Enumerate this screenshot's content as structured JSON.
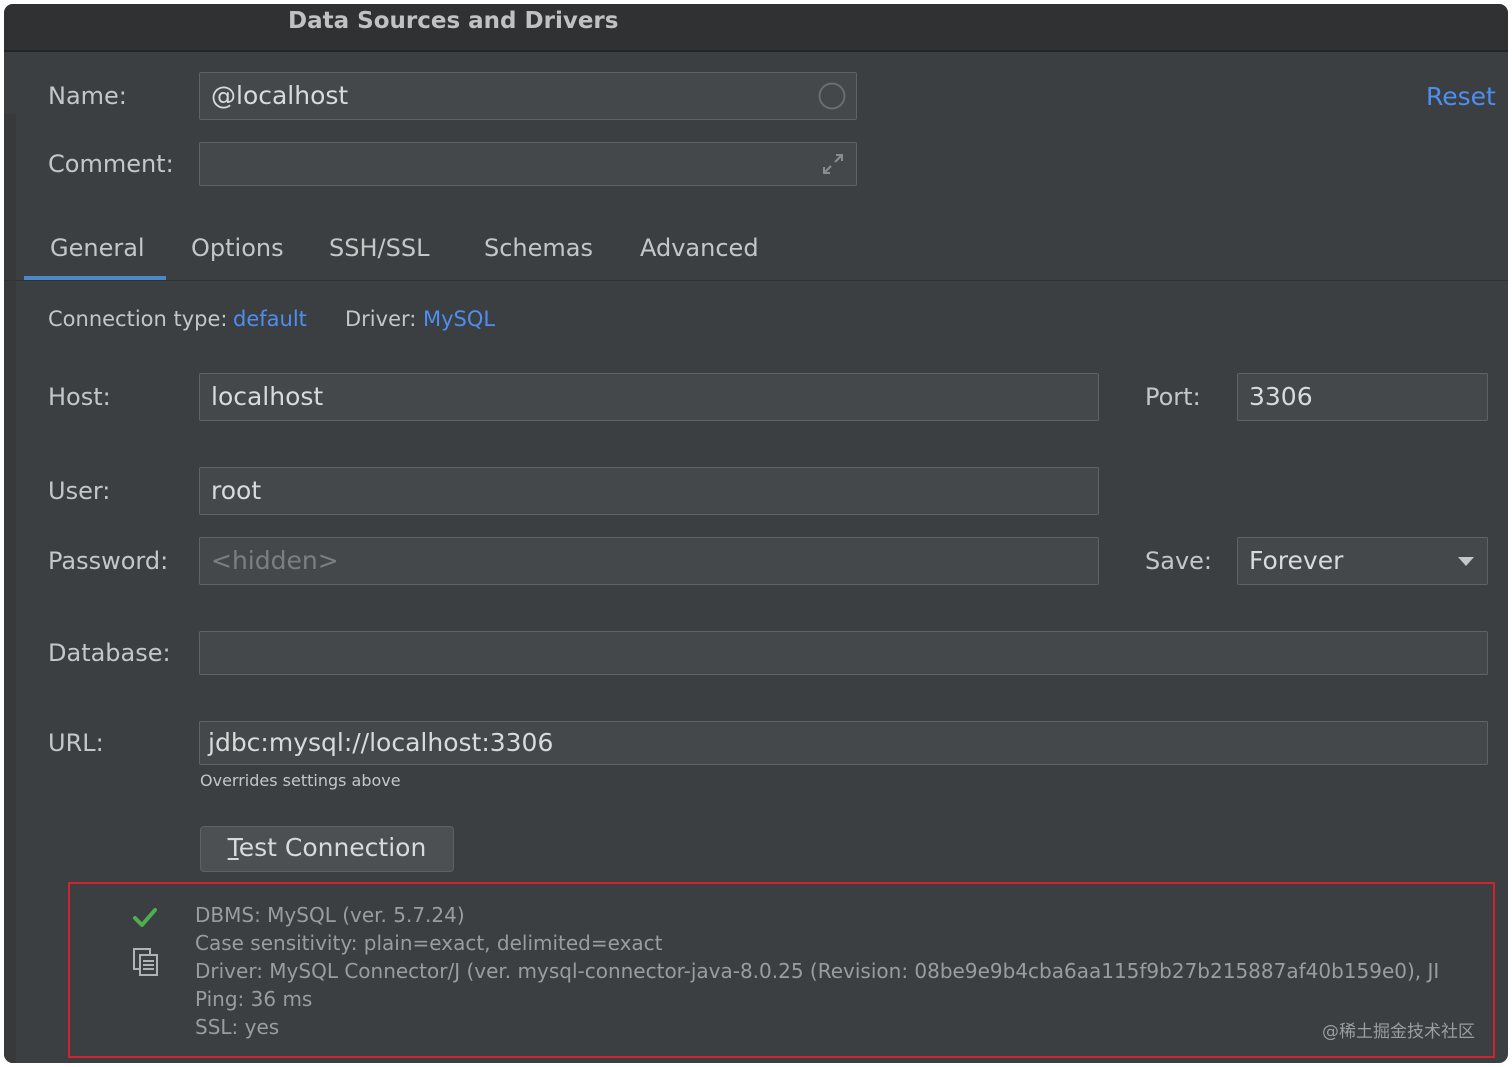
{
  "window": {
    "title": "Data Sources and Drivers"
  },
  "header": {
    "name_label": "Name:",
    "name_value": "@localhost",
    "comment_label": "Comment:",
    "comment_value": "",
    "reset_label": "Reset"
  },
  "tabs": [
    {
      "label": "General",
      "active": true
    },
    {
      "label": "Options",
      "active": false
    },
    {
      "label": "SSH/SSL",
      "active": false
    },
    {
      "label": "Schemas",
      "active": false
    },
    {
      "label": "Advanced",
      "active": false
    }
  ],
  "general": {
    "connection_type_label": "Connection type:",
    "connection_type_value": "default",
    "driver_label": "Driver:",
    "driver_value": "MySQL",
    "host_label": "Host:",
    "host_value": "localhost",
    "port_label": "Port:",
    "port_value": "3306",
    "user_label": "User:",
    "user_value": "root",
    "password_label": "Password:",
    "password_placeholder": "<hidden>",
    "save_label": "Save:",
    "save_value": "Forever",
    "database_label": "Database:",
    "database_value": "",
    "url_label": "URL:",
    "url_value": "jdbc:mysql://localhost:3306",
    "url_hint": "Overrides settings above",
    "test_button_mnemonic": "T",
    "test_button_rest": "est Connection"
  },
  "result": {
    "status": "success",
    "icons": [
      "check-icon",
      "copy-icon"
    ],
    "lines": [
      "DBMS: MySQL (ver. 5.7.24)",
      "Case sensitivity: plain=exact, delimited=exact",
      "Driver: MySQL Connector/J (ver. mysql-connector-java-8.0.25 (Revision: 08be9e9b4cba6aa115f9b27b215887af40b159e0), JI",
      "Ping: 36 ms",
      "SSL: yes"
    ]
  },
  "watermark": "@稀土掘金技术社区",
  "colors": {
    "accent_link": "#4e8ef0",
    "tab_underline": "#4a88c7",
    "highlight_border": "#d3232e",
    "success_check": "#4caf50"
  }
}
